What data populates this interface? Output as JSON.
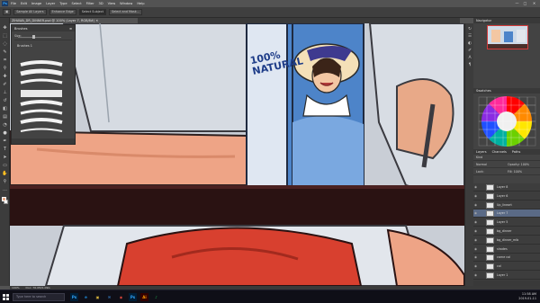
{
  "menubar": {
    "logo": "Ps",
    "items": [
      "File",
      "Edit",
      "Image",
      "Layer",
      "Type",
      "Select",
      "Filter",
      "3D",
      "View",
      "Window",
      "Help"
    ],
    "win_minimize": "—",
    "win_maximize": "□",
    "win_close": "✕"
  },
  "optionsbar": {
    "items": [
      "Sample All Layers",
      "Enhance Edge",
      "Select Subject",
      "Select and Mask..."
    ]
  },
  "document": {
    "tab_title": "ZIHAWA_DR_DINNER.psd @ 100% (Layer 7, RGB/8#) ✕"
  },
  "brushes_panel": {
    "title": "Brushes",
    "size_label": "Size:",
    "group_label": "Brushes 1"
  },
  "navigator": {
    "title": "Navigator"
  },
  "color_panel": {
    "title": "Swatches",
    "wheel_colors": [
      "#ff0000",
      "#ff8a00",
      "#ffe600",
      "#6cd000",
      "#00b0a0",
      "#2050ff",
      "#8a2be2",
      "#ff2a9a"
    ]
  },
  "layers_panel": {
    "tabs": [
      "Layers",
      "Channels",
      "Paths"
    ],
    "kind_label": "Kind",
    "blend_mode": "Normal",
    "opacity_label": "Opacity: 100%",
    "lock_label": "Lock:",
    "fill_label": "Fill: 100%",
    "layers": [
      {
        "name": "Layer 8",
        "visible": true,
        "selected": false
      },
      {
        "name": "Layer 6",
        "visible": true,
        "selected": false
      },
      {
        "name": "Up_lineart",
        "visible": true,
        "selected": false
      },
      {
        "name": "Layer 7",
        "visible": true,
        "selected": true
      },
      {
        "name": "Layer 5",
        "visible": true,
        "selected": false
      },
      {
        "name": "bg_dinner",
        "visible": true,
        "selected": false
      },
      {
        "name": "bg_dinner_mlb",
        "visible": true,
        "selected": false
      },
      {
        "name": "shades",
        "visible": true,
        "selected": false
      },
      {
        "name": "carne col",
        "visible": true,
        "selected": false
      },
      {
        "name": "col",
        "visible": true,
        "selected": false
      },
      {
        "name": "Layer 1",
        "visible": true,
        "selected": false
      }
    ]
  },
  "comic": {
    "banner_text": "100% NATURAL"
  },
  "statusbar": {
    "zoom": "100%",
    "doc_size": "Doc: 76.0M/1.09G"
  },
  "taskbar": {
    "search_placeholder": "Type here to search",
    "time": "11:58 AM",
    "date": "2019-01-11",
    "apps": [
      {
        "label": "Ps",
        "bg": "#001e36",
        "fg": "#31a8ff"
      },
      {
        "label": "e",
        "bg": "#0f0f17",
        "fg": "#1f8fe0"
      },
      {
        "label": "▣",
        "bg": "#0f0f17",
        "fg": "#d9b43c"
      },
      {
        "label": "✉",
        "bg": "#0f0f17",
        "fg": "#3c8ede"
      },
      {
        "label": "◉",
        "bg": "#0f0f17",
        "fg": "#e0473c"
      },
      {
        "label": "Ps",
        "bg": "#001e36",
        "fg": "#31a8ff"
      },
      {
        "label": "Ai",
        "bg": "#330000",
        "fg": "#ff9a00"
      },
      {
        "label": "♪",
        "bg": "#0f0f17",
        "fg": "#1db954"
      }
    ]
  }
}
